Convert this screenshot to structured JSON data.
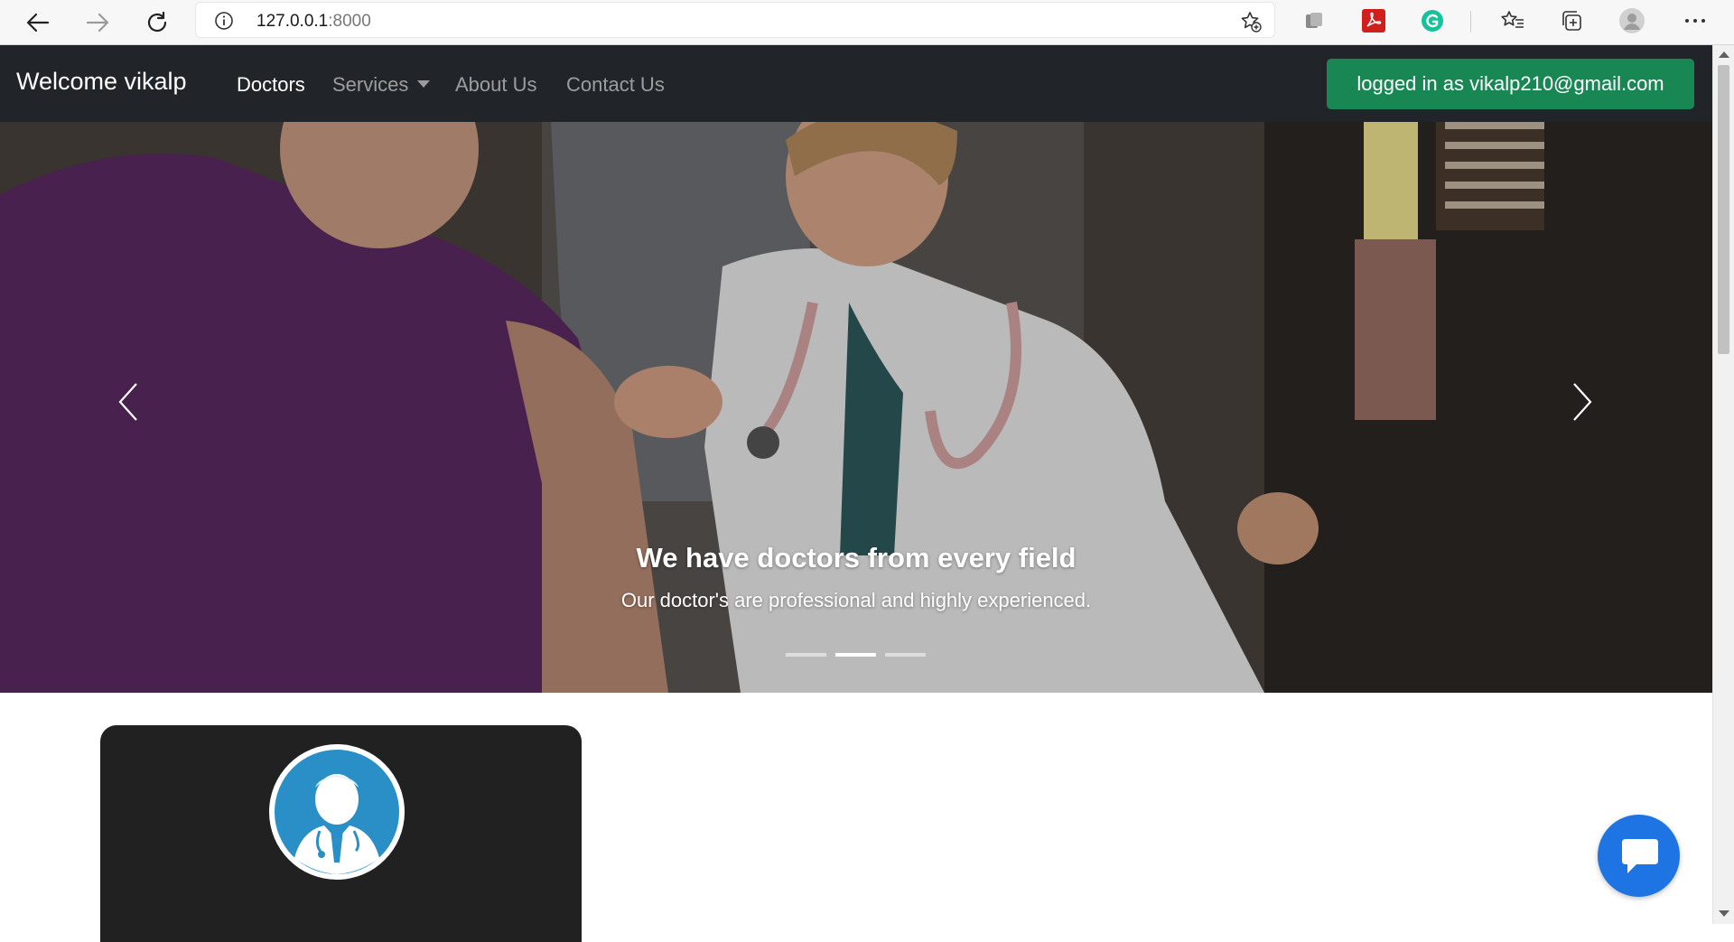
{
  "browser": {
    "address_host": "127.0.0.1",
    "address_port": ":8000",
    "icons": [
      "back-arrow-icon",
      "forward-arrow-icon",
      "reload-icon",
      "site-info-icon",
      "add-favorite-icon",
      "extension-icon",
      "pdf-icon",
      "grammarly-icon",
      "favorites-icon",
      "collections-icon",
      "profile-icon",
      "more-icon"
    ]
  },
  "navbar": {
    "brand": "Welcome vikalp",
    "links": [
      {
        "label": "Doctors",
        "active": true
      },
      {
        "label": "Services",
        "dropdown": true
      },
      {
        "label": "About Us"
      },
      {
        "label": "Contact Us"
      }
    ],
    "login_badge": "logged in as vikalp210@gmail.com"
  },
  "carousel": {
    "caption_title": "We have doctors from every field",
    "caption_text": "Our doctor's are professional and highly experienced.",
    "indicators": 3,
    "active_index": 1
  },
  "doctor_card": {
    "avatar_icon": "doctor-avatar-icon"
  },
  "chat": {
    "icon": "chat-bubble-icon"
  },
  "colors": {
    "navbar_bg": "#212529",
    "login_badge_bg": "#198754",
    "card_bg": "#212121",
    "chat_button_bg": "#1e74e3",
    "avatar_blue": "#2b8fc7"
  }
}
